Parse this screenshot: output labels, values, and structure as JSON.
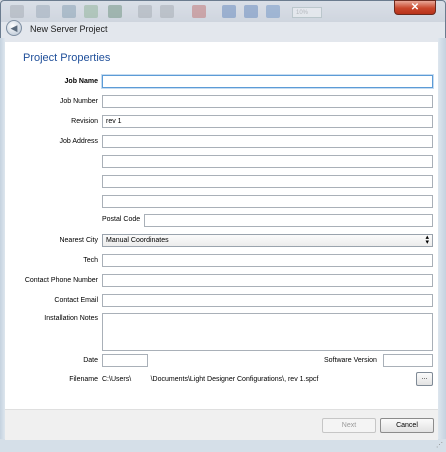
{
  "window": {
    "title": "New Server Project",
    "close_glyph": "✕",
    "back_glyph": "◀"
  },
  "toolbar": {
    "zoom": "10%"
  },
  "page": {
    "heading": "Project Properties"
  },
  "form": {
    "job_name": {
      "label": "Job Name",
      "value": ""
    },
    "job_number": {
      "label": "Job Number",
      "value": ""
    },
    "revision": {
      "label": "Revision",
      "value": "rev 1"
    },
    "job_address": {
      "label": "Job Address",
      "lines": [
        "",
        "",
        "",
        ""
      ]
    },
    "postal_code": {
      "label": "Postal Code",
      "value": ""
    },
    "nearest_city": {
      "label": "Nearest City",
      "value": "Manual Coordinates"
    },
    "tech": {
      "label": "Tech",
      "value": ""
    },
    "contact_phone": {
      "label": "Contact Phone Number",
      "value": ""
    },
    "contact_email": {
      "label": "Contact Email",
      "value": ""
    },
    "installation_notes": {
      "label": "Installation Notes",
      "value": ""
    },
    "date": {
      "label": "Date",
      "value": ""
    },
    "software_version": {
      "label": "Software Version",
      "value": ""
    },
    "filename": {
      "label": "Filename",
      "value": "C:\\Users\\          \\Documents\\Light Designer Configurations\\, rev 1.spcf"
    }
  },
  "buttons": {
    "browse": "...",
    "next": "Next",
    "cancel": "Cancel"
  },
  "colors": {
    "heading": "#1f4f9a",
    "focus_border": "#5c9bd6",
    "close_button": "#c9472c"
  }
}
